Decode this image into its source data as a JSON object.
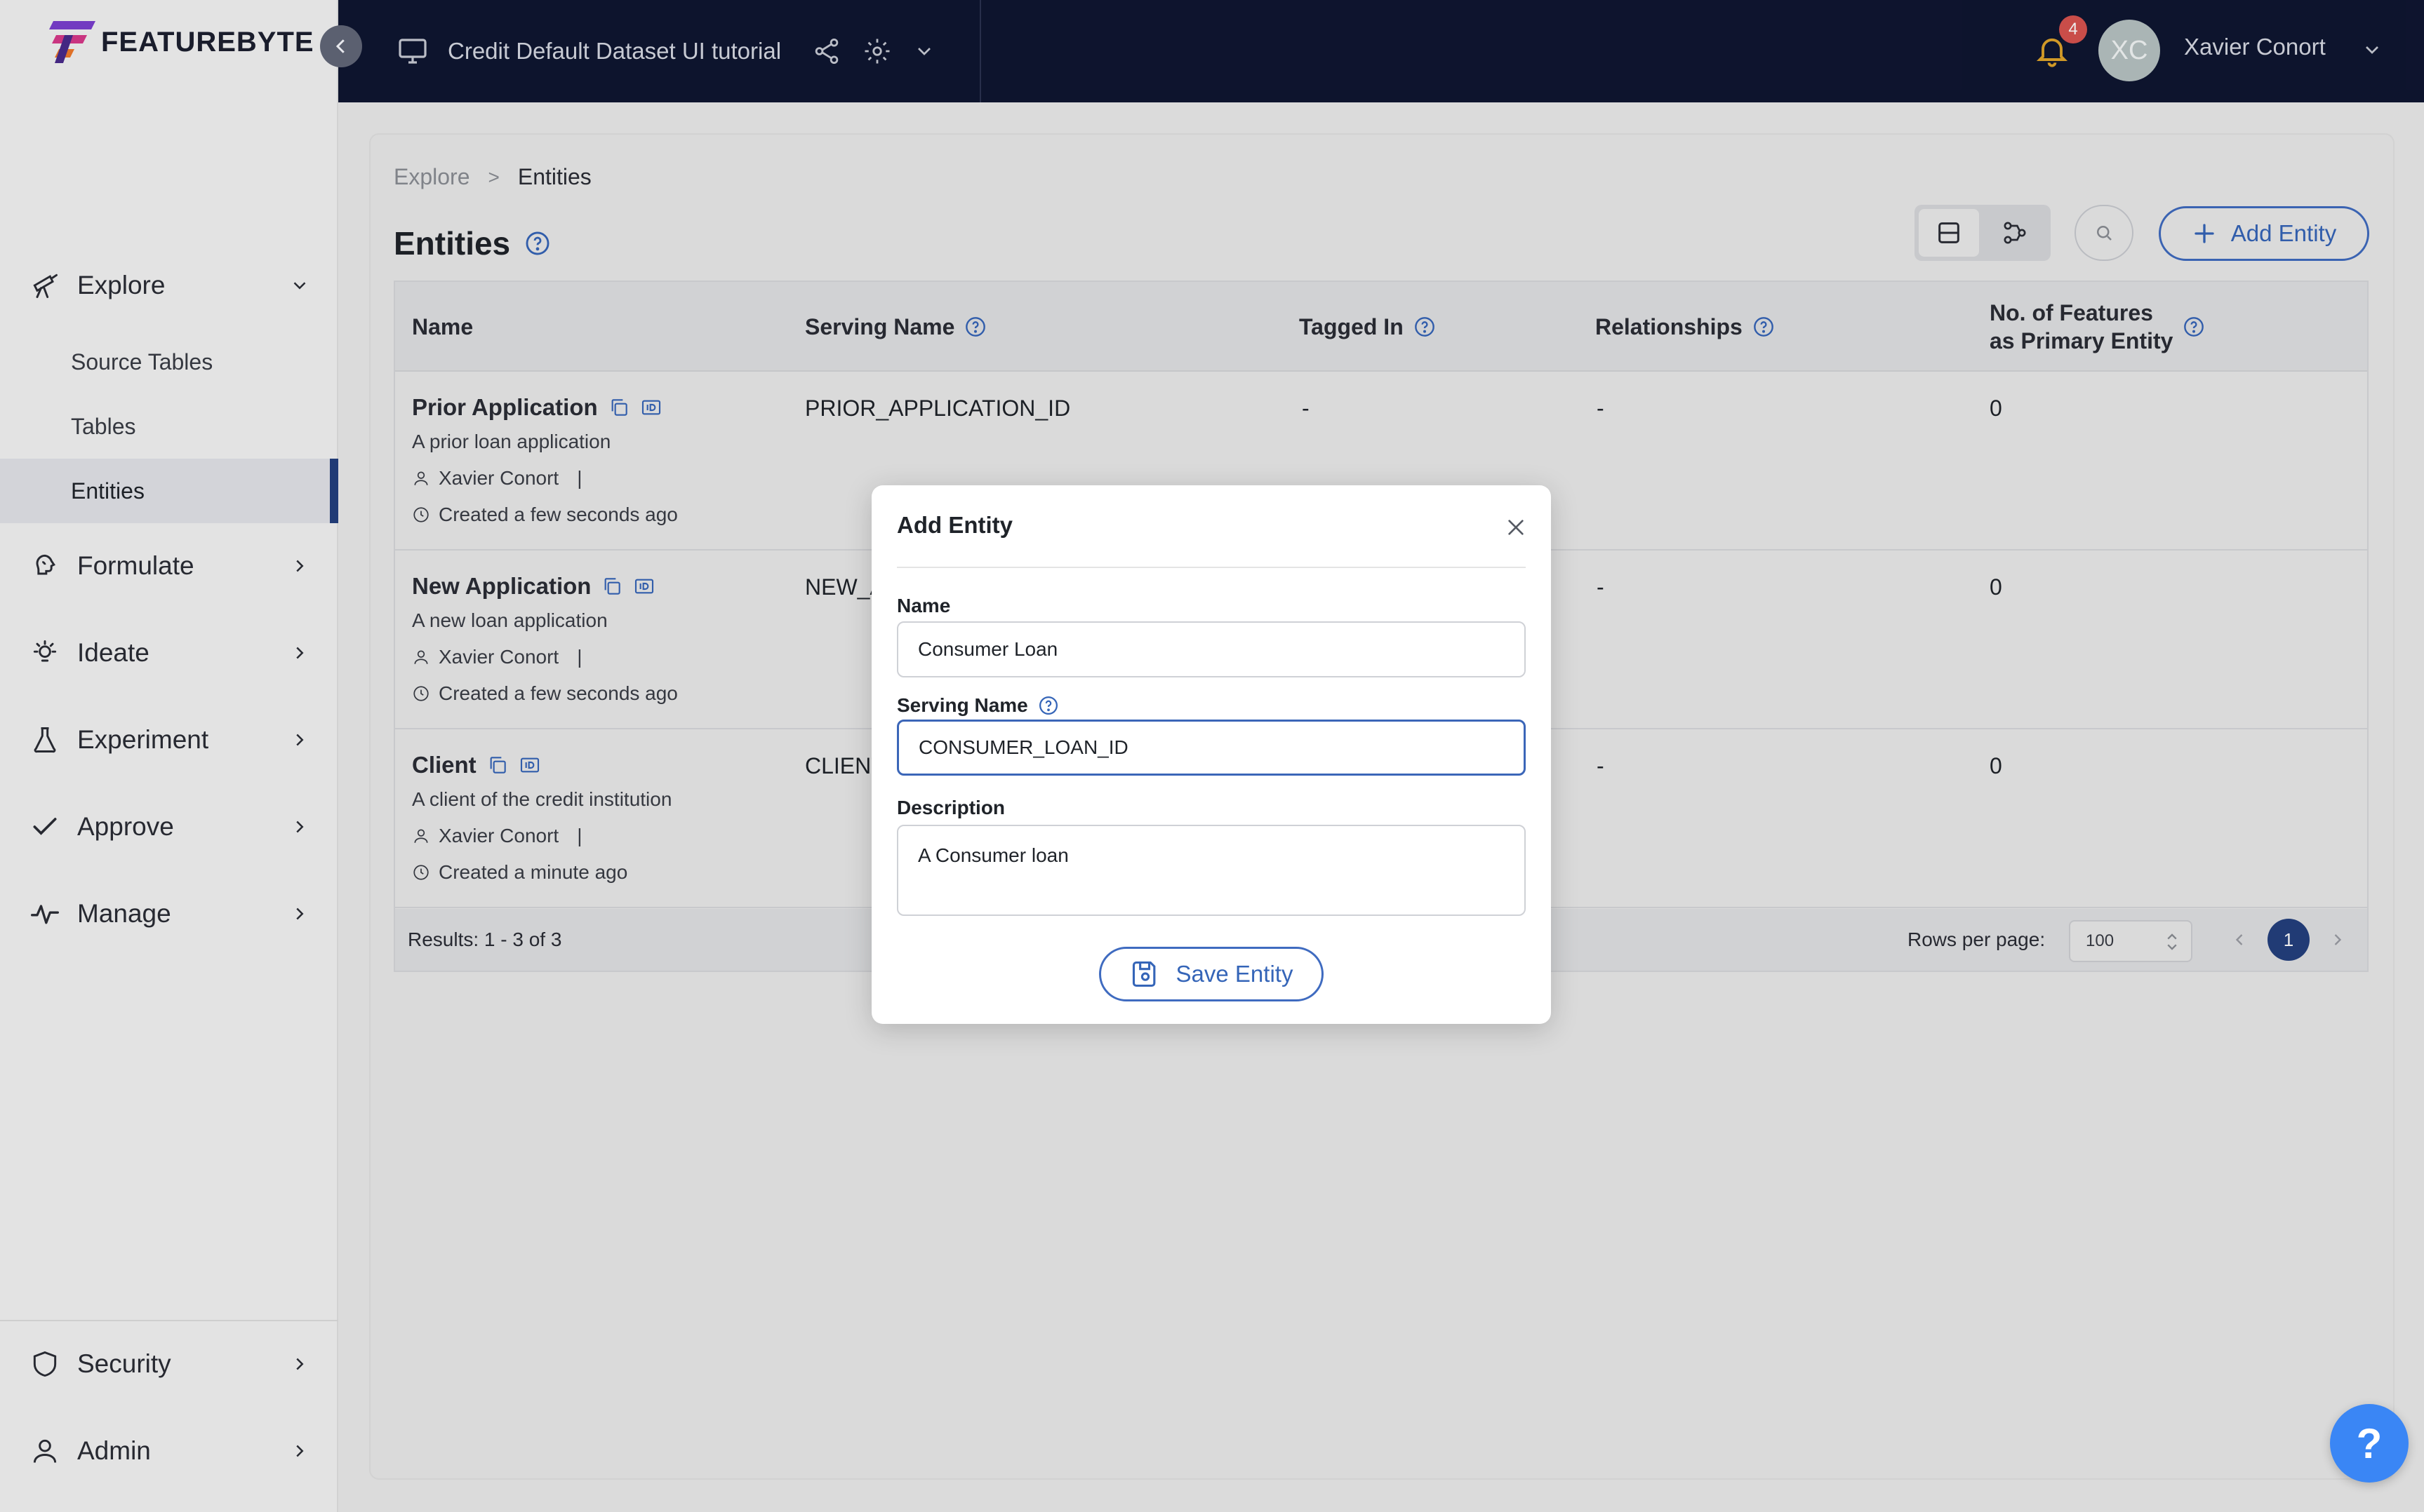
{
  "app": {
    "logo_text": "FEATUREBYTE",
    "catalog_title": "Credit Default Dataset UI tutorial",
    "notification_count": "4",
    "user_initials": "XC",
    "user_name": "Xavier Conort"
  },
  "sidebar": {
    "explore": "Explore",
    "sub_items": [
      "Source Tables",
      "Tables",
      "Entities"
    ],
    "formulate": "Formulate",
    "ideate": "Ideate",
    "experiment": "Experiment",
    "approve": "Approve",
    "manage": "Manage",
    "security": "Security",
    "admin": "Admin"
  },
  "breadcrumb": {
    "parent": "Explore",
    "separator": ">",
    "current": "Entities"
  },
  "page": {
    "title": "Entities",
    "add_button": "Add Entity"
  },
  "table": {
    "columns": {
      "name": "Name",
      "serving_name": "Serving Name",
      "tagged_in": "Tagged In",
      "relationships": "Relationships",
      "features_line1": "No. of Features",
      "features_line2": "as Primary Entity"
    },
    "rows": [
      {
        "name": "Prior Application",
        "description": "A prior loan application",
        "owner": "Xavier Conort",
        "created": "Created a few seconds ago",
        "serving_name": "PRIOR_APPLICATION_ID",
        "tagged_in": "-",
        "relationships": "-",
        "features": "0"
      },
      {
        "name": "New Application",
        "description": "A new loan application",
        "owner": "Xavier Conort",
        "created": "Created a few seconds ago",
        "serving_name": "NEW_A",
        "tagged_in": "",
        "relationships": "-",
        "features": "0"
      },
      {
        "name": "Client",
        "description": "A client of the credit institution",
        "owner": "Xavier Conort",
        "created": "Created a minute ago",
        "serving_name": "CLIENT",
        "tagged_in": "",
        "relationships": "-",
        "features": "0"
      }
    ],
    "results": "Results: 1 - 3 of 3",
    "rows_per_page_label": "Rows per page:",
    "rows_per_page_value": "100",
    "current_page": "1"
  },
  "modal": {
    "title": "Add Entity",
    "name_label": "Name",
    "name_value": "Consumer Loan",
    "serving_label": "Serving Name",
    "serving_value": "CONSUMER_LOAN_ID",
    "description_label": "Description",
    "description_value": "A Consumer loan",
    "save_button": "Save Entity"
  },
  "help": {
    "label": "?"
  },
  "colors": {
    "header_bg": "#0f1631",
    "accent": "#3565b8",
    "active_nav": "#24407e",
    "badge": "#d9534f",
    "help_fab": "#3a86f5"
  },
  "icons": [
    "telescope-icon",
    "brain-icon",
    "lightbulb-icon",
    "flask-icon",
    "check-icon",
    "pulse-icon",
    "shield-icon",
    "user-icon",
    "monitor-icon",
    "share-icon",
    "gear-icon",
    "bell-icon",
    "copy-icon",
    "id-card-icon",
    "clock-icon",
    "search-icon",
    "plus-icon",
    "close-icon",
    "save-icon",
    "help-circle-icon"
  ]
}
